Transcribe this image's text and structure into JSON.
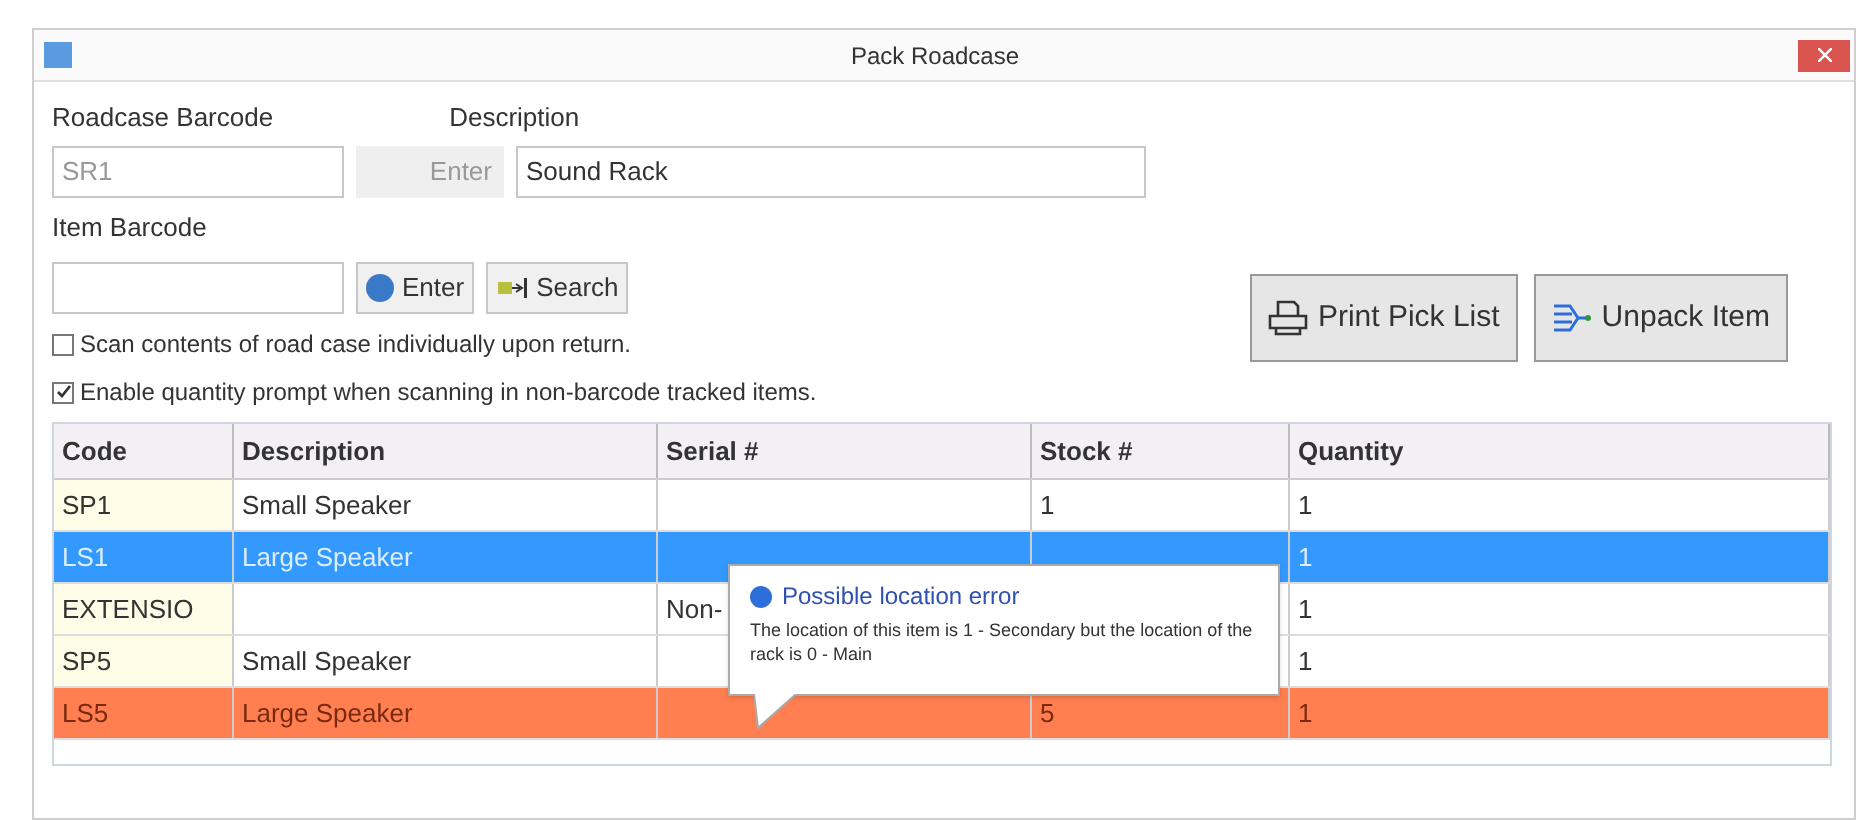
{
  "window": {
    "title": "Pack Roadcase"
  },
  "roadcase_barcode": {
    "label": "Roadcase Barcode",
    "value": "SR1",
    "disabled": true
  },
  "roadcase_enter": {
    "label": "Enter",
    "disabled": true
  },
  "description": {
    "label": "Description",
    "value": "Sound Rack"
  },
  "item_barcode": {
    "label": "Item Barcode"
  },
  "item_buttons": [
    {
      "label": "Enter",
      "kind": "enter"
    },
    {
      "label": "Search",
      "kind": "search"
    }
  ],
  "options": [
    {
      "label": "Scan contents of road case individually upon return.",
      "checked": false
    },
    {
      "label": "Enable quantity prompt when scanning in non-barcode tracked items.",
      "checked": true
    }
  ],
  "actions": [
    {
      "label": "Print Pick List",
      "kind": "print"
    },
    {
      "label": "Unpack Item",
      "kind": "unpack"
    }
  ],
  "table": {
    "columns": [
      "Code",
      "Description",
      "Serial #",
      "Stock #",
      "Quantity"
    ],
    "rows": [
      {
        "cells": [
          "SP1",
          "Small Speaker",
          "",
          "1",
          "1"
        ],
        "selected": false,
        "kind": "plain"
      },
      {
        "cells": [
          "LS1",
          "Large Speaker",
          "",
          "",
          "1"
        ],
        "selected": true,
        "kind": "plain"
      },
      {
        "cells": [
          "EXTENSIO",
          "",
          "Non-",
          "",
          "1"
        ],
        "selected": false,
        "kind": "plain"
      },
      {
        "cells": [
          "SP5",
          "Small Speaker",
          "",
          "",
          "1"
        ],
        "selected": false,
        "kind": "plain"
      },
      {
        "cells": [
          "LS5",
          "Large Speaker",
          "",
          "5",
          "1"
        ],
        "selected": false,
        "kind": "warning"
      }
    ]
  },
  "tooltip": {
    "title": "Possible location error",
    "text": "The location of this item is 1 - Secondary but the location of the rack is 0 - Main"
  }
}
